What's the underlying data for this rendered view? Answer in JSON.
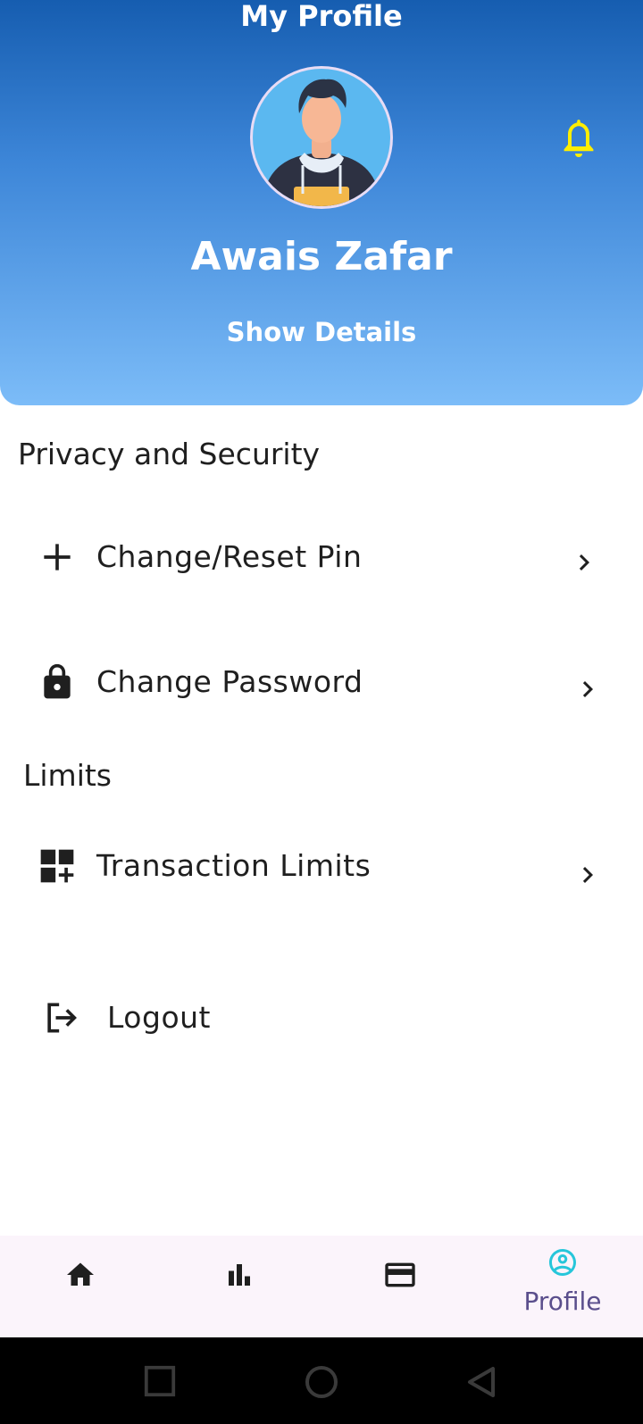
{
  "header": {
    "title": "My Profile",
    "user_name": "Awais Zafar",
    "show_details_label": "Show Details"
  },
  "sections": [
    {
      "title": "Privacy and Security",
      "items": [
        {
          "label": "Change/Reset Pin",
          "icon": "plus-icon"
        },
        {
          "label": "Change Password",
          "icon": "lock-icon"
        }
      ]
    },
    {
      "title": "Limits",
      "items": [
        {
          "label": "Transaction Limits",
          "icon": "dashboard-add-icon"
        }
      ]
    }
  ],
  "logout_label": "Logout",
  "bottom_nav": {
    "items": [
      {
        "icon": "home-icon",
        "label": ""
      },
      {
        "icon": "bar-chart-icon",
        "label": ""
      },
      {
        "icon": "credit-card-icon",
        "label": ""
      },
      {
        "icon": "account-circle-icon",
        "label": "Profile",
        "active": true
      }
    ]
  },
  "colors": {
    "header_top": "#165db0",
    "header_bottom": "#7cbcf8",
    "bell": "#ffee00",
    "active_nav_icon": "#26c6da",
    "active_nav_label": "#5a4e8c",
    "nav_bg": "#fbf4fb"
  }
}
